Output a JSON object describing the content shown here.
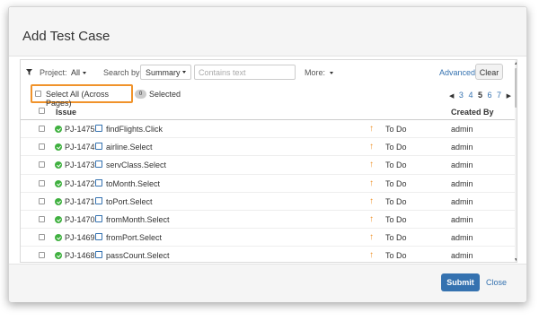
{
  "dialog": {
    "title": "Add Test Case"
  },
  "filters": {
    "funnel_icon": "funnel-icon",
    "project_label": "Project:",
    "project_value": "All",
    "search_by_label": "Search by",
    "search_by_value": "Summary",
    "text_placeholder": "Contains text",
    "more_label": "More:",
    "advanced_label": "Advanced",
    "clear_label": "Clear"
  },
  "selection": {
    "select_all_label": "Select All (Across Pages)",
    "count": "0",
    "selected_label": "Selected"
  },
  "pagination": {
    "pages": [
      "3",
      "4",
      "5",
      "6",
      "7"
    ],
    "current": "5"
  },
  "table": {
    "headers": {
      "issue": "Issue",
      "created_by": "Created By"
    },
    "rows": [
      {
        "key": "PJ-1475",
        "summary": "findFlights.Click",
        "status": "To Do",
        "created_by": "admin"
      },
      {
        "key": "PJ-1474",
        "summary": "airline.Select",
        "status": "To Do",
        "created_by": "admin"
      },
      {
        "key": "PJ-1473",
        "summary": "servClass.Select",
        "status": "To Do",
        "created_by": "admin"
      },
      {
        "key": "PJ-1472",
        "summary": "toMonth.Select",
        "status": "To Do",
        "created_by": "admin"
      },
      {
        "key": "PJ-1471",
        "summary": "toPort.Select",
        "status": "To Do",
        "created_by": "admin"
      },
      {
        "key": "PJ-1470",
        "summary": "fromMonth.Select",
        "status": "To Do",
        "created_by": "admin"
      },
      {
        "key": "PJ-1469",
        "summary": "fromPort.Select",
        "status": "To Do",
        "created_by": "admin"
      },
      {
        "key": "PJ-1468",
        "summary": "passCount.Select",
        "status": "To Do",
        "created_by": "admin"
      }
    ]
  },
  "footer": {
    "submit_label": "Submit",
    "close_label": "Close"
  },
  "colors": {
    "accent": "#3572b0",
    "highlight": "#f0932b",
    "issue_type": "#3fb03f"
  }
}
